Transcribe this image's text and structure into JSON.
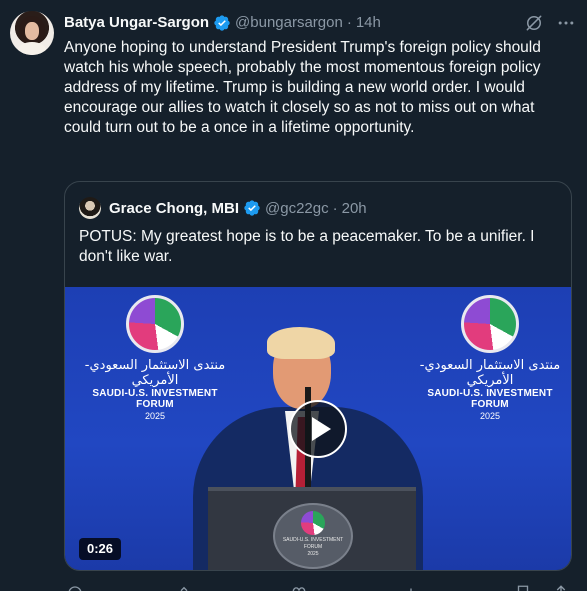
{
  "tweet": {
    "author": {
      "display_name": "Batya Ungar-Sargon",
      "handle": "@bungarsargon",
      "verified": true
    },
    "time": "14h",
    "dot": "·",
    "text": "Anyone hoping to understand President Trump's foreign policy should watch his whole speech, probably the most momentous foreign policy address of my lifetime. Trump is building a new world order. I would encourage our allies to watch it closely so as not to miss out on what could turn out to be a once in a lifetime opportunity."
  },
  "quote": {
    "author": {
      "display_name": "Grace Chong, MBI",
      "handle": "@gc22gc",
      "verified": true
    },
    "dot": "·",
    "time": "20h",
    "text": "POTUS: My greatest hope is to be a peacemaker. To be a unifier. I don't like war.",
    "video": {
      "duration": "0:26",
      "forum_arabic": "منتدى الاستثمار السعودي-الأمريكي",
      "forum_english": "SAUDI-U.S. INVESTMENT FORUM",
      "forum_year": "2025"
    }
  },
  "icons": {
    "verified": "verified-badge-icon",
    "grok": "grok-icon",
    "more": "more-icon",
    "play": "play-icon"
  },
  "colors": {
    "background": "#15202b",
    "text_primary": "#f7f9f9",
    "text_secondary": "#8b98a5",
    "verified_blue": "#1d9bf0",
    "border": "#38444d"
  }
}
